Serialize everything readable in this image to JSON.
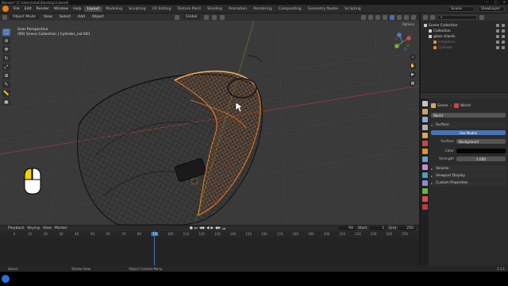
{
  "window": {
    "title": "Blender* [C:\\Users\\mtali\\Desktop\\1.blend]"
  },
  "menu": {
    "items": [
      "File",
      "Edit",
      "Render",
      "Window",
      "Help"
    ],
    "workspaces": [
      "Layout",
      "Modeling",
      "Sculpting",
      "UV Editing",
      "Texture Paint",
      "Shading",
      "Animation",
      "Rendering",
      "Compositing",
      "Geometry Nodes",
      "Scripting"
    ],
    "active_workspace": "Layout",
    "scene": "Scene",
    "view_layer": "ViewLayer"
  },
  "viewport_header": {
    "mode": "Object Mode",
    "menus": [
      "View",
      "Select",
      "Add",
      "Object"
    ],
    "orientation": "Global",
    "options_label": "Options"
  },
  "viewport": {
    "view_name": "User Perspective",
    "collection_path": "(90) Scene Collection | Cylinder_col.041"
  },
  "timeline": {
    "menus": [
      "Playback",
      "Keying",
      "View",
      "Marker"
    ],
    "current_frame": "90",
    "start_label": "Start",
    "start": "1",
    "end_label": "End",
    "end": "250",
    "ticks": [
      "0",
      "10",
      "20",
      "30",
      "40",
      "50",
      "60",
      "70",
      "80",
      "90",
      "100",
      "110",
      "120",
      "130",
      "140",
      "150",
      "160",
      "170",
      "180",
      "190",
      "200",
      "210",
      "220",
      "230",
      "240",
      "250"
    ]
  },
  "status": {
    "items": [
      "Select",
      "Rotate View",
      "Object Context Menu"
    ],
    "version": "3.3.1"
  },
  "outliner": {
    "header_label": "Scene Collection",
    "rows": [
      {
        "label": "Scene Collection",
        "color": "#cfcfcf",
        "indent": 0,
        "dim": false
      },
      {
        "label": "Collection",
        "color": "#cfcfcf",
        "indent": 1,
        "dim": false
      },
      {
        "label": "glass shards",
        "color": "#cfcfcf",
        "indent": 1,
        "dim": false
      },
      {
        "label": "Icosphere",
        "color": "#e0922c",
        "indent": 2,
        "dim": true
      },
      {
        "label": "Cylinder",
        "color": "#e0922c",
        "indent": 2,
        "dim": true
      }
    ]
  },
  "properties": {
    "breadcrumb_scene": "Scene",
    "breadcrumb_world": "World",
    "world_name": "World",
    "surface_panel": "Surface",
    "use_nodes": "Use Nodes",
    "surface_label": "Surface",
    "surface_value": "Background",
    "color_label": "Color",
    "strength_label": "Strength",
    "strength_value": "1.000",
    "volume_panel": "Volume",
    "viewport_display_panel": "Viewport Display",
    "custom_properties_panel": "Custom Properties"
  },
  "colors": {
    "accent": "#4772b3",
    "selection": "#f27b21",
    "brand": "#e87d0d"
  }
}
